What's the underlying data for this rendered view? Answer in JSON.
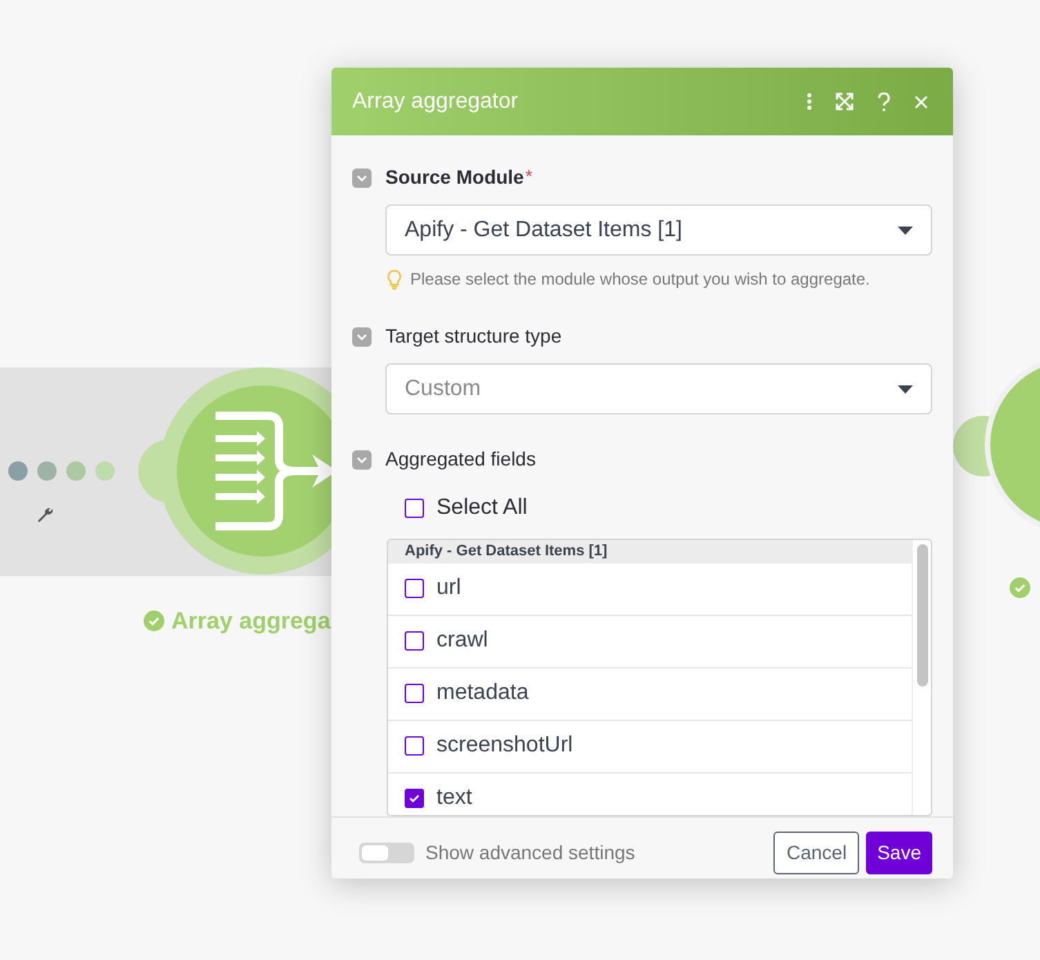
{
  "canvas": {
    "node": {
      "label": "Array aggrega"
    }
  },
  "dialog": {
    "title": "Array aggregator",
    "sections": [
      {
        "kind": "select",
        "label": "Source Module",
        "required_mark": "*",
        "value": "Apify - Get Dataset Items [1]",
        "placeholder_style": false,
        "hint": "Please select the module whose output you wish to aggregate."
      },
      {
        "kind": "select",
        "label": "Target structure type",
        "value": "Custom",
        "placeholder_style": true
      },
      {
        "kind": "fields",
        "label": "Aggregated fields",
        "select_all": {
          "label": "Select All",
          "checked": false
        },
        "group": "Apify - Get Dataset Items [1]",
        "items": [
          {
            "label": "url",
            "checked": false
          },
          {
            "label": "crawl",
            "checked": false
          },
          {
            "label": "metadata",
            "checked": false
          },
          {
            "label": "screenshotUrl",
            "checked": false
          },
          {
            "label": "text",
            "checked": true
          }
        ]
      }
    ],
    "footer": {
      "advanced": {
        "label": "Show advanced settings",
        "on": false
      },
      "buttons": [
        {
          "label": "Cancel",
          "kind": "secondary"
        },
        {
          "label": "Save",
          "kind": "primary"
        }
      ]
    }
  }
}
